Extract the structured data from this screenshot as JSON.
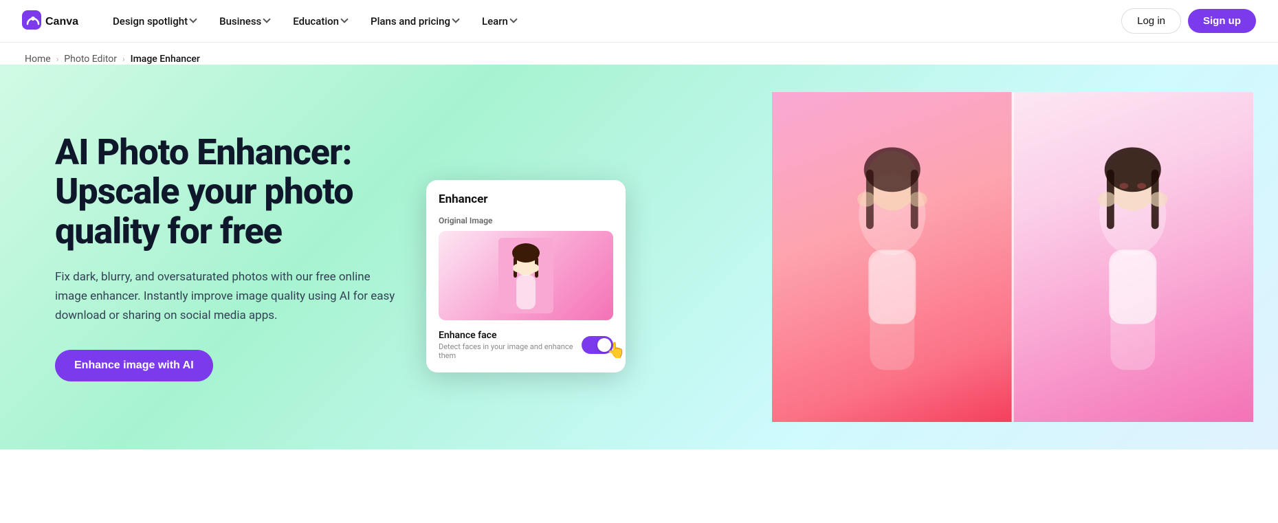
{
  "brand": {
    "name": "Canva"
  },
  "nav": {
    "items": [
      {
        "id": "design-spotlight",
        "label": "Design spotlight",
        "hasDropdown": true
      },
      {
        "id": "business",
        "label": "Business",
        "hasDropdown": true
      },
      {
        "id": "education",
        "label": "Education",
        "hasDropdown": true
      },
      {
        "id": "plans-pricing",
        "label": "Plans and pricing",
        "hasDropdown": true
      },
      {
        "id": "learn",
        "label": "Learn",
        "hasDropdown": true
      }
    ],
    "login_label": "Log in",
    "signup_label": "Sign up"
  },
  "breadcrumb": {
    "home_label": "Home",
    "photo_editor_label": "Photo Editor",
    "current_label": "Image Enhancer"
  },
  "hero": {
    "title": "AI Photo Enhancer: Upscale your photo quality for free",
    "description": "Fix dark, blurry, and oversaturated photos with our free online image enhancer. Instantly improve image quality using AI for easy download or sharing on social media apps.",
    "cta_label": "Enhance image with AI"
  },
  "enhancer_card": {
    "title": "Enhancer",
    "section_label": "Original Image",
    "toggle_label": "Enhance face",
    "toggle_sub": "Detect faces in your image and enhance them"
  }
}
